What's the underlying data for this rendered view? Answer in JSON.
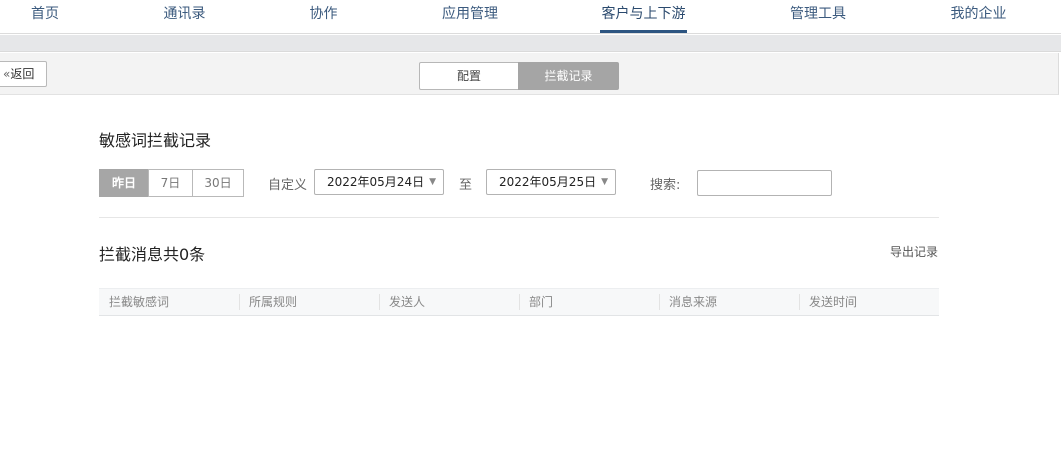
{
  "nav": {
    "items": [
      "首页",
      "通讯录",
      "协作",
      "应用管理",
      "客户与上下游",
      "管理工具",
      "我的企业"
    ],
    "active_index": 4
  },
  "subbar": {
    "back_label": "返回",
    "back_icon": "double-chevron-left-icon",
    "tabs": [
      "配置",
      "拦截记录"
    ],
    "active_tab": "拦截记录"
  },
  "main": {
    "title": "敏感词拦截记录",
    "ranges": [
      "昨日",
      "7日",
      "30日"
    ],
    "active_range": "昨日",
    "custom_label": "自定义",
    "start_date": "2022年05月24日",
    "to_label": "至",
    "end_date": "2022年05月25日",
    "search_label": "搜索:",
    "search_value": "",
    "count_title": "拦截消息共0条",
    "export_label": "导出记录",
    "table_headers": [
      "拦截敏感词",
      "所属规则",
      "发送人",
      "部门",
      "消息来源",
      "发送时间"
    ],
    "rows": []
  },
  "colors": {
    "nav_text": "#3b5a7e",
    "nav_active_underline": "#2d5581",
    "active_segment": "#a5a5a5"
  }
}
